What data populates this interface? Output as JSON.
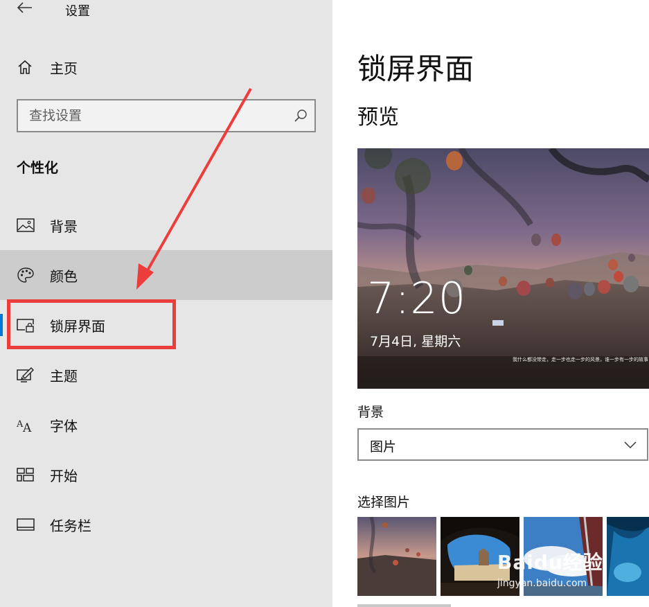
{
  "app": {
    "title": "设置"
  },
  "home": {
    "label": "主页"
  },
  "search": {
    "placeholder": "查找设置"
  },
  "section": {
    "title": "个性化"
  },
  "nav": {
    "items": [
      {
        "label": "背景",
        "icon": "picture-icon"
      },
      {
        "label": "颜色",
        "icon": "palette-icon"
      },
      {
        "label": "锁屏界面",
        "icon": "lock-screen-icon"
      },
      {
        "label": "主题",
        "icon": "theme-icon"
      },
      {
        "label": "字体",
        "icon": "font-icon"
      },
      {
        "label": "开始",
        "icon": "start-icon"
      },
      {
        "label": "任务栏",
        "icon": "taskbar-icon"
      }
    ],
    "selected": "锁屏界面",
    "hovered": "颜色"
  },
  "main": {
    "title": "锁屏界面",
    "preview_heading": "预览",
    "preview": {
      "time": "7:20",
      "date": "7月4日, 星期六",
      "caption": "我什么都没带走，走一步也走一步的风景，谁一步有一步的故事"
    },
    "background_label": "背景",
    "background_value": "图片",
    "choose_label": "选择图片"
  },
  "watermark": {
    "brand": "Baidu经验",
    "url": "jingyan.baidu.com"
  },
  "colors": {
    "accent": "#0078d7",
    "annotation": "#ec3d3d",
    "sidebar_bg": "#e6e6e6",
    "hover_bg": "#cccccc"
  }
}
